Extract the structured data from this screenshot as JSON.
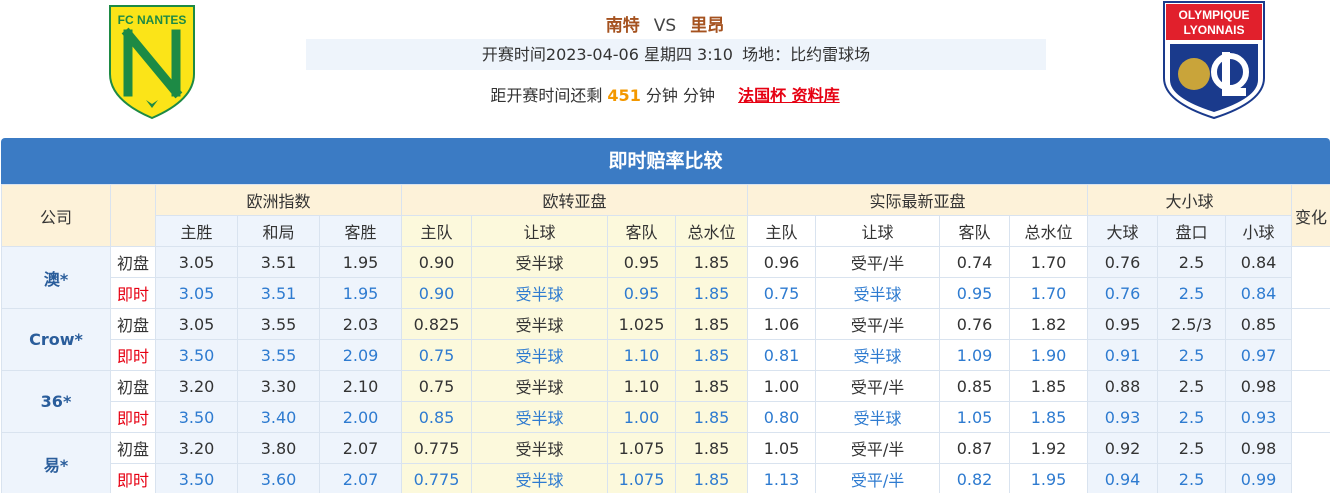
{
  "header": {
    "home_team": "南特",
    "vs": "VS",
    "away_team": "里昂",
    "home_logo_text": "FC NANTES",
    "away_logo_text_1": "OLYMPIQUE",
    "away_logo_text_2": "LYONNAIS",
    "kickoff": "开赛时间2023-04-06 星期四 3:10",
    "venue": "场地：比约雷球场",
    "countdown_prefix": "距开赛时间还剩",
    "countdown_minutes": "451",
    "countdown_suffix": "分钟 分钟",
    "league_link": "法国杯 资料库"
  },
  "table": {
    "title": "即时赔率比较",
    "headers": {
      "company": "公司",
      "european": "欧洲指数",
      "eu_to_asian": "欧转亚盘",
      "actual_asian": "实际最新亚盘",
      "over_under": "大小球",
      "change": "变化",
      "home_win": "主胜",
      "draw": "和局",
      "away_win": "客胜",
      "home_team": "主队",
      "handicap": "让球",
      "away_team": "客队",
      "total_water": "总水位",
      "over": "大球",
      "line": "盘口",
      "under": "小球"
    },
    "labels": {
      "initial": "初盘",
      "live": "即时"
    },
    "rows": [
      {
        "company": "澳*",
        "initial": [
          "3.05",
          "3.51",
          "1.95",
          "0.90",
          "受半球",
          "0.95",
          "1.85",
          "0.96",
          "受平/半",
          "0.74",
          "1.70",
          "0.76",
          "2.5",
          "0.84"
        ],
        "live": [
          "3.05",
          "3.51",
          "1.95",
          "0.90",
          "受半球",
          "0.95",
          "1.85",
          "0.75",
          "受半球",
          "0.95",
          "1.70",
          "0.76",
          "2.5",
          "0.84"
        ]
      },
      {
        "company": "Crow*",
        "initial": [
          "3.05",
          "3.55",
          "2.03",
          "0.825",
          "受半球",
          "1.025",
          "1.85",
          "1.06",
          "受平/半",
          "0.76",
          "1.82",
          "0.95",
          "2.5/3",
          "0.85"
        ],
        "live": [
          "3.50",
          "3.55",
          "2.09",
          "0.75",
          "受半球",
          "1.10",
          "1.85",
          "0.81",
          "受半球",
          "1.09",
          "1.90",
          "0.91",
          "2.5",
          "0.97"
        ]
      },
      {
        "company": "36*",
        "initial": [
          "3.20",
          "3.30",
          "2.10",
          "0.75",
          "受半球",
          "1.10",
          "1.85",
          "1.00",
          "受平/半",
          "0.85",
          "1.85",
          "0.88",
          "2.5",
          "0.98"
        ],
        "live": [
          "3.50",
          "3.40",
          "2.00",
          "0.85",
          "受半球",
          "1.00",
          "1.85",
          "0.80",
          "受半球",
          "1.05",
          "1.85",
          "0.93",
          "2.5",
          "0.93"
        ]
      },
      {
        "company": "易*",
        "initial": [
          "3.20",
          "3.80",
          "2.07",
          "0.775",
          "受半球",
          "1.075",
          "1.85",
          "1.05",
          "受平/半",
          "0.87",
          "1.92",
          "0.92",
          "2.5",
          "0.98"
        ],
        "live": [
          "3.50",
          "3.60",
          "2.07",
          "0.775",
          "受半球",
          "1.075",
          "1.85",
          "1.13",
          "受平/半",
          "0.82",
          "1.95",
          "0.94",
          "2.5",
          "0.99"
        ]
      }
    ]
  },
  "colors": {
    "title_bar": "#3b7bc4",
    "team_name": "#a5521f",
    "live_value": "#2e7bd0",
    "live_label": "#e60012",
    "countdown_number": "#f39800"
  }
}
